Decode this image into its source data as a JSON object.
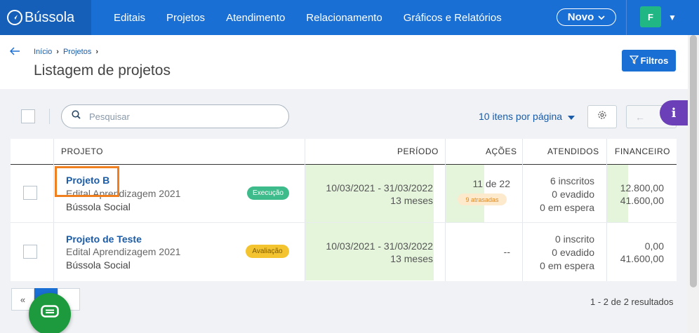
{
  "navbar": {
    "brand": "Bússola",
    "links": [
      "Editais",
      "Projetos",
      "Atendimento",
      "Relacionamento",
      "Gráficos e Relatórios"
    ],
    "novo_label": "Novo",
    "avatar_initial": "F"
  },
  "header": {
    "breadcrumb": [
      "Início",
      "Projetos"
    ],
    "title": "Listagem de projetos",
    "filtros_label": "Filtros"
  },
  "toolbar": {
    "search_placeholder": "Pesquisar",
    "per_page_label": "10 itens por página"
  },
  "table": {
    "columns": [
      "PROJETO",
      "PERÍODO",
      "AÇÕES",
      "ATENDIDOS",
      "FINANCEIRO"
    ],
    "rows": [
      {
        "name": "Projeto B",
        "edital": "Edital Aprendizagem 2021",
        "org": "Bússola Social",
        "status": "Execução",
        "status_color": "#3dbb8a",
        "periodo": "10/03/2021 - 31/03/2022",
        "duracao": "13 meses",
        "acoes": "11 de 22",
        "acoes_badge": "9 atrasadas",
        "inscritos": "6 inscritos",
        "evadidos": "0 evadido",
        "espera": "0 em espera",
        "fin_executado": "12.800,00",
        "fin_total": "41.600,00"
      },
      {
        "name": "Projeto de Teste",
        "edital": "Edital Aprendizagem 2021",
        "org": "Bússola Social",
        "status": "Avaliação",
        "status_color": "#f4c430",
        "periodo": "10/03/2021 - 31/03/2022",
        "duracao": "13 meses",
        "acoes": "--",
        "inscritos": "0 inscrito",
        "evadidos": "0 evadido",
        "espera": "0 em espera",
        "fin_executado": "0,00",
        "fin_total": "41.600,00"
      }
    ]
  },
  "pagination": {
    "first_label": "«",
    "results": "1 - 2 de 2 resultados"
  },
  "colors": {
    "primary": "#1a6fd4",
    "highlight": "#f07f1f",
    "info_fab": "#6a3fb8",
    "chat_fab": "#1e9a3e"
  }
}
